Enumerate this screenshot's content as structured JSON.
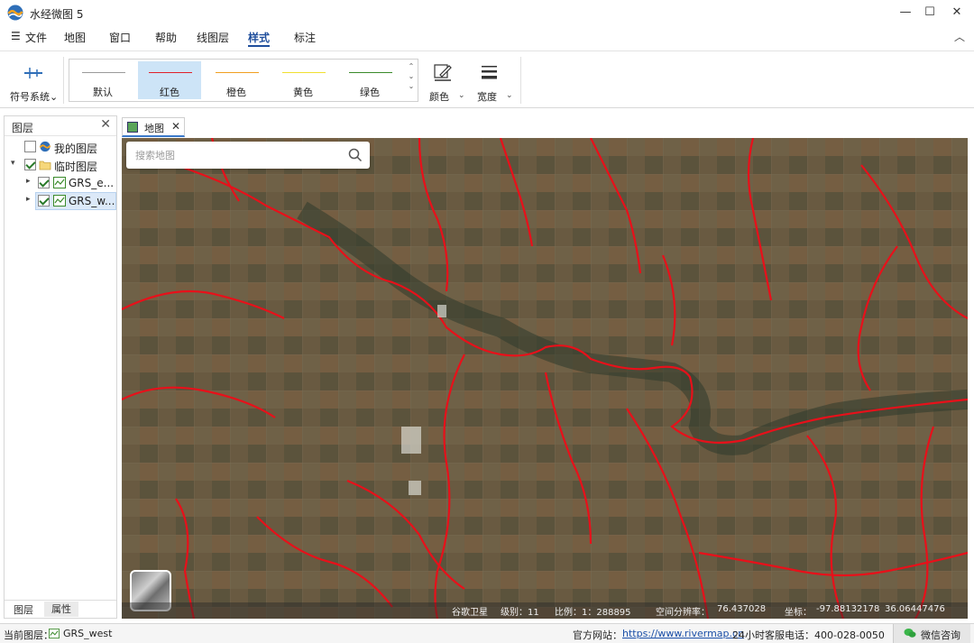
{
  "app": {
    "title": "水经微图 5",
    "window_controls": {
      "minimize": "—",
      "maximize": "☐",
      "close": "✕"
    }
  },
  "menu": {
    "items": [
      {
        "label": "文件",
        "prefix": "☰"
      },
      {
        "label": "地图"
      },
      {
        "label": "窗口"
      },
      {
        "label": "帮助"
      },
      {
        "label": "线图层"
      },
      {
        "label": "样式",
        "active": true
      },
      {
        "label": "标注"
      }
    ],
    "collapse_icon": "︿"
  },
  "ribbon": {
    "symbol_system": "符号系统",
    "styles": [
      {
        "label": "默认",
        "color": "#9a9a9a"
      },
      {
        "label": "红色",
        "color": "#e0202a",
        "selected": true
      },
      {
        "label": "橙色",
        "color": "#f0a020"
      },
      {
        "label": "黄色",
        "color": "#f0e030"
      },
      {
        "label": "绿色",
        "color": "#3a8a2a"
      }
    ],
    "color_label": "颜色",
    "width_label": "宽度"
  },
  "layers_panel": {
    "title": "图层",
    "close": "✕",
    "tree": [
      {
        "label": "我的图层",
        "checked": false,
        "icon": "globe-icon",
        "indent": 0,
        "expander": ""
      },
      {
        "label": "临时图层",
        "checked": true,
        "icon": "folder-icon",
        "indent": 0,
        "expander": "▾"
      },
      {
        "label": "GRS_e...",
        "checked": true,
        "icon": "polyline-layer-icon",
        "indent": 1,
        "expander": "▸"
      },
      {
        "label": "GRS_w...",
        "checked": true,
        "icon": "polyline-layer-icon",
        "indent": 1,
        "expander": "▸",
        "selected": true
      }
    ],
    "tabs": [
      "图层",
      "属性"
    ]
  },
  "doc_tab": {
    "label": "地图",
    "close": "✕"
  },
  "map": {
    "search_placeholder": "搜索地图",
    "status": {
      "source": "谷歌卫星",
      "level": "级别：11",
      "scale": "比例：1：288895",
      "resolution": "空间分辨率：",
      "resolution_value": "76.437028",
      "coord_label": "坐标：",
      "lon": "-97.88132178",
      "lat": "36.06447476"
    },
    "colors": {
      "river": "#e8101a"
    }
  },
  "statusbar": {
    "current_layer_label": "当前图层：",
    "current_layer": "GRS_west",
    "website_label": "官方网站：",
    "website_url": "https://www.rivermap.cn",
    "hotline": "24小时客服电话：400-028-0050",
    "wechat": "微信咨询"
  }
}
